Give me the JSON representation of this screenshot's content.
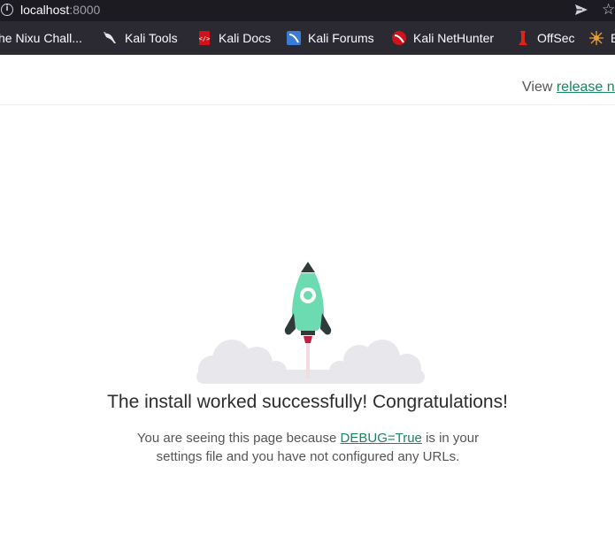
{
  "browser": {
    "url_host": "localhost",
    "url_port": ":8000"
  },
  "bookmarks": [
    {
      "label": "he Nixu Chall...",
      "icon": "nixu-icon"
    },
    {
      "label": "Kali Tools",
      "icon": "kali-dragon-icon"
    },
    {
      "label": "Kali Docs",
      "icon": "kali-docs-icon"
    },
    {
      "label": "Kali Forums",
      "icon": "kali-forums-icon"
    },
    {
      "label": "Kali NetHunter",
      "icon": "kali-nethunter-icon"
    },
    {
      "label": "OffSec",
      "icon": "offsec-icon"
    },
    {
      "label": "E",
      "icon": "exploit-db-icon"
    }
  ],
  "page": {
    "view_prefix": "View ",
    "release_link": "release notes",
    "headline": "The install worked successfully! Congratulations!",
    "explain_1": "You are seeing this page because ",
    "explain_link": "DEBUG=True",
    "explain_2": " is in your settings file and you have not configured any URLs."
  },
  "colors": {
    "link_green": "#19865c",
    "rocket_body": "#6ddbb1",
    "cloud": "#e8e8ec"
  }
}
